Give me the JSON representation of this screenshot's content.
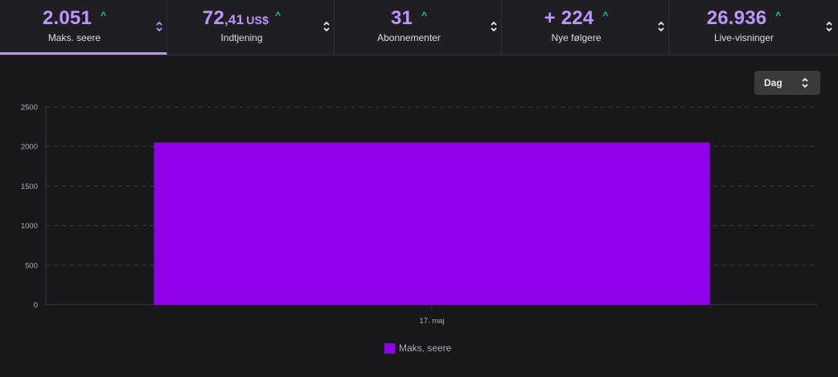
{
  "stats": [
    {
      "value_main": "2.051",
      "value_dec": "",
      "unit": "",
      "label": "Maks. seere",
      "active": true
    },
    {
      "value_main": "72",
      "value_dec": ",41",
      "unit": "US$",
      "label": "Indtjening",
      "active": false
    },
    {
      "value_main": "31",
      "value_dec": "",
      "unit": "",
      "label": "Abonnementer",
      "active": false
    },
    {
      "value_main": "+ 224",
      "value_dec": "",
      "unit": "",
      "label": "Nye følgere",
      "active": false
    },
    {
      "value_main": "26.936",
      "value_dec": "",
      "unit": "",
      "label": "Live-visninger",
      "active": false
    }
  ],
  "trend_icon": "arrow-up-icon",
  "sort_icon": "sort-icon",
  "period_dropdown": {
    "label": "Dag"
  },
  "colors": {
    "accent": "#bf94ff",
    "bar": "#9100ea",
    "trend_up": "#00d3a8",
    "background": "#18181b",
    "header": "#1f1f23"
  },
  "chart_data": {
    "type": "bar",
    "categories": [
      "17. maj"
    ],
    "series": [
      {
        "name": "Maks. seere",
        "values": [
          2051
        ]
      }
    ],
    "ylim": [
      0,
      2500
    ],
    "yticks": [
      0,
      500,
      1000,
      1500,
      2000,
      2500
    ],
    "grid": true,
    "legend": "bottom-center",
    "title": "",
    "xlabel": "",
    "ylabel": ""
  }
}
